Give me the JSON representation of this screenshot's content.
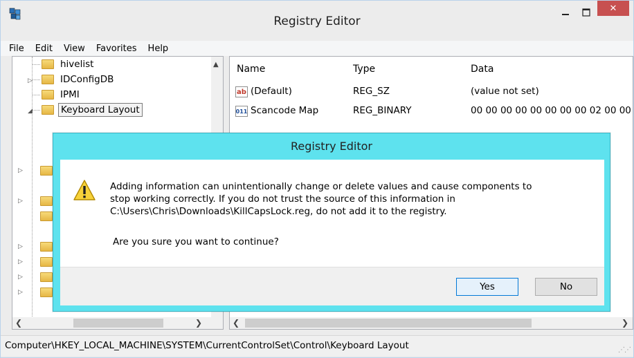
{
  "window": {
    "title": "Registry Editor",
    "minimize_glyph": "—",
    "close_glyph": "✕"
  },
  "menu": {
    "items": [
      "File",
      "Edit",
      "View",
      "Favorites",
      "Help"
    ]
  },
  "tree": {
    "items": [
      {
        "label": "hivelist"
      },
      {
        "label": "IDConfigDB"
      },
      {
        "label": "IPMI"
      },
      {
        "label": "Keyboard Layout"
      }
    ]
  },
  "list": {
    "headers": {
      "name": "Name",
      "type": "Type",
      "data": "Data"
    },
    "rows": [
      {
        "icon": "ab",
        "name": "(Default)",
        "type": "REG_SZ",
        "data": "(value not set)"
      },
      {
        "icon": "011",
        "name": "Scancode Map",
        "type": "REG_BINARY",
        "data": "00 00 00 00 00 00 00 00 02 00 00"
      }
    ]
  },
  "status": {
    "path": "Computer\\HKEY_LOCAL_MACHINE\\SYSTEM\\CurrentControlSet\\Control\\Keyboard Layout"
  },
  "dialog": {
    "title": "Registry Editor",
    "message_lines": [
      "Adding information can unintentionally change or delete values and cause components to",
      "stop working correctly. If you do not trust the source of this information in",
      "C:\\Users\\Chris\\Downloads\\KillCapsLock.reg, do not add it to the registry."
    ],
    "question": "Are you sure you want to continue?",
    "yes_label": "Yes",
    "no_label": "No"
  },
  "colors": {
    "dialog_frame": "#5ee2ee",
    "close_button": "#c75050",
    "default_button_border": "#0078d7"
  }
}
